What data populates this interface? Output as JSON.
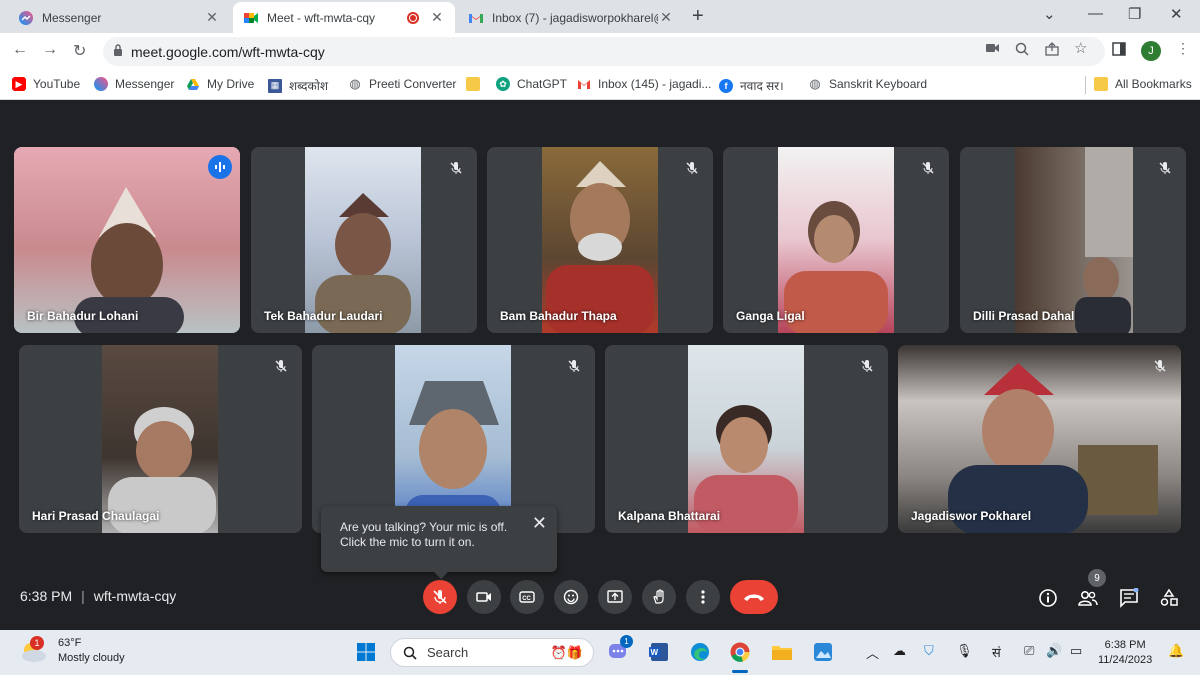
{
  "browser": {
    "tabs": [
      {
        "title": "Messenger",
        "icon": "messenger-icon"
      },
      {
        "title": "Meet - wft-mwta-cqy",
        "icon": "meet-icon"
      },
      {
        "title": "Inbox (7) - jagadisworpokharel@",
        "icon": "gmail-icon"
      }
    ],
    "url": "meet.google.com/wft-mwta-cqy",
    "profile_initial": "J",
    "bookmarks": [
      {
        "label": "YouTube",
        "icon": "youtube-icon"
      },
      {
        "label": "Messenger",
        "icon": "messenger-icon"
      },
      {
        "label": "My Drive",
        "icon": "drive-icon"
      },
      {
        "label": "शब्दकोश",
        "icon": "dictionary-icon"
      },
      {
        "label": "Preeti Converter",
        "icon": "globe-icon"
      },
      {
        "label": "",
        "icon": "folder-icon"
      },
      {
        "label": "ChatGPT",
        "icon": "chatgpt-icon"
      },
      {
        "label": "Inbox (145) - jagadi...",
        "icon": "gmail-icon"
      },
      {
        "label": "नवाद सर।",
        "icon": "facebook-icon"
      },
      {
        "label": "Sanskrit Keyboard",
        "icon": "globe-icon"
      }
    ],
    "all_bookmarks": "All Bookmarks"
  },
  "meet": {
    "participants": [
      {
        "name": "Bir Bahadur Lohani",
        "speaking": true
      },
      {
        "name": "Tek Bahadur Laudari",
        "speaking": false
      },
      {
        "name": "Bam Bahadur Thapa",
        "speaking": false
      },
      {
        "name": "Ganga Ligal",
        "speaking": false
      },
      {
        "name": "Dilli Prasad Dahal",
        "speaking": false
      },
      {
        "name": "Hari Prasad Chaulagai",
        "speaking": false
      },
      {
        "name": "",
        "speaking": false
      },
      {
        "name": "Kalpana Bhattarai",
        "speaking": false
      },
      {
        "name": "Jagadiswor Pokharel",
        "speaking": false
      }
    ],
    "popup": {
      "line1": "Are you talking? Your mic is off.",
      "line2": "Click the mic to turn it on."
    },
    "time": "6:38 PM",
    "meeting_code": "wft-mwta-cqy",
    "people_count": "9",
    "colors": {
      "accent": "#8ab4f8",
      "danger": "#ea4335",
      "bg": "#202124",
      "tile": "#3c4043"
    }
  },
  "taskbar": {
    "weather_temp": "63°F",
    "weather_desc": "Mostly cloudy",
    "weather_badge": "1",
    "search_placeholder": "Search",
    "chat_badge": "1",
    "ime": "सं",
    "time": "6:38 PM",
    "date": "11/24/2023"
  }
}
